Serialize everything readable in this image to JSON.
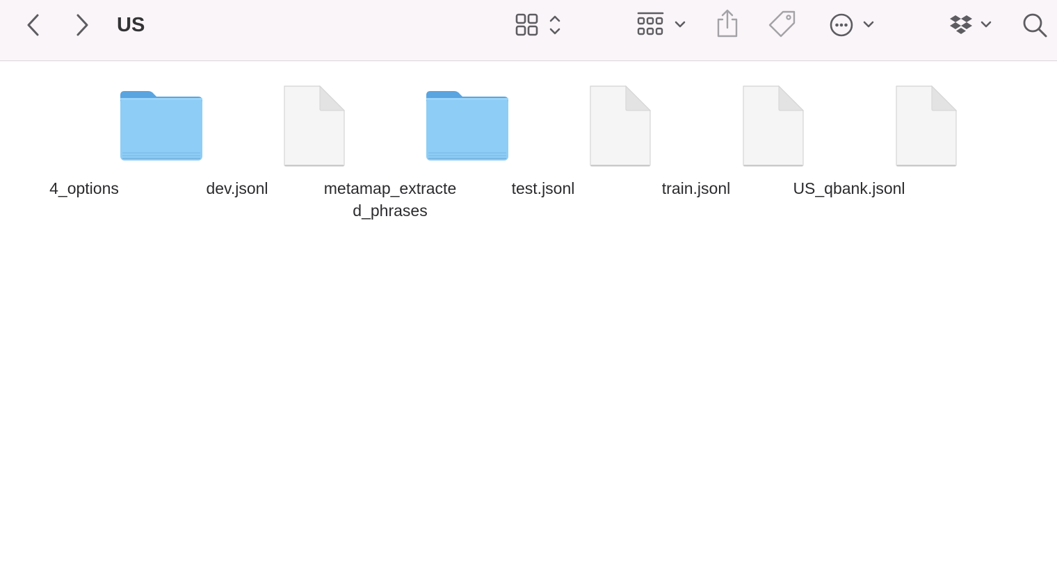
{
  "window": {
    "title": "US"
  },
  "toolbar": {
    "back_icon": "chevron-left-icon",
    "forward_icon": "chevron-right-icon",
    "view_icon": "icon-grid-view-icon",
    "group_icon": "group-by-icon",
    "share_icon": "share-icon",
    "tag_icon": "tag-icon",
    "more_icon": "ellipsis-circle-icon",
    "dropbox_icon": "dropbox-icon",
    "search_icon": "search-icon"
  },
  "colors": {
    "toolbar_bg": "#f9f5f8",
    "folder_blue": "#8dcdf6",
    "folder_tab": "#5aa4e0",
    "doc_fill": "#f5f5f5"
  },
  "files": [
    {
      "name": "4_options",
      "kind": "folder"
    },
    {
      "name": "dev.jsonl",
      "kind": "document"
    },
    {
      "name": "metamap_extracted_phrases",
      "kind": "folder"
    },
    {
      "name": "test.jsonl",
      "kind": "document"
    },
    {
      "name": "train.jsonl",
      "kind": "document"
    },
    {
      "name": "US_qbank.jsonl",
      "kind": "document"
    }
  ]
}
